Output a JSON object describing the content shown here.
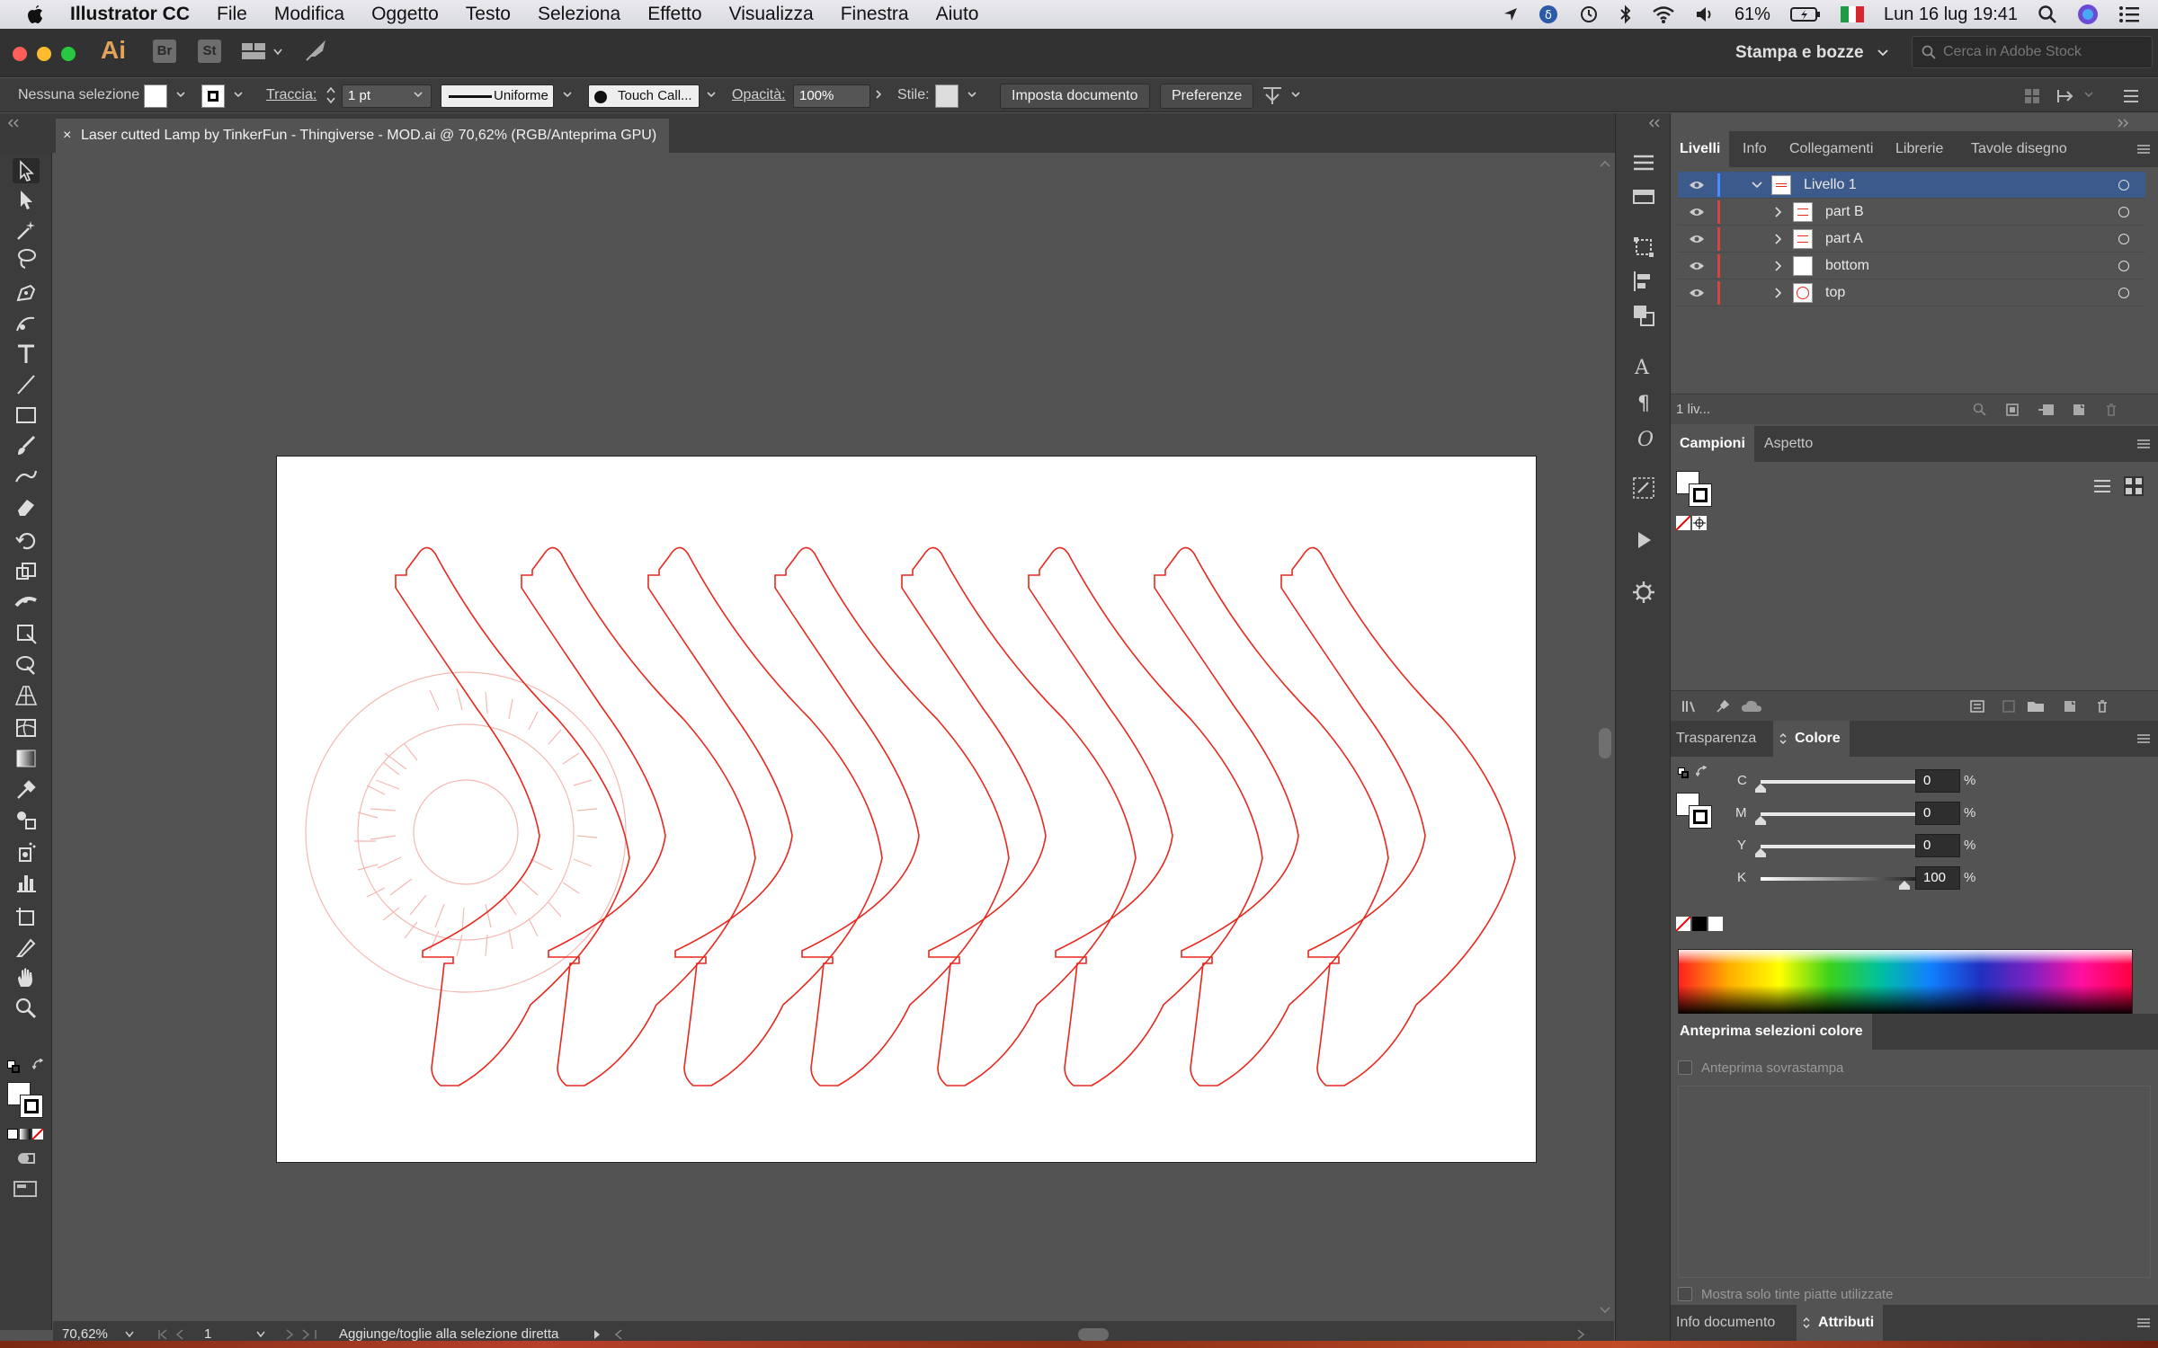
{
  "menubar": {
    "app": "Illustrator CC",
    "items": [
      "File",
      "Modifica",
      "Oggetto",
      "Testo",
      "Seleziona",
      "Effetto",
      "Visualizza",
      "Finestra",
      "Aiuto"
    ],
    "battery": "61%",
    "datetime": "Lun 16 lug 19:41"
  },
  "appbar": {
    "ai_logo": "Ai",
    "bridge": "Br",
    "stock": "St",
    "workspace": "Stampa e bozze",
    "stock_search_placeholder": "Cerca in Adobe Stock"
  },
  "control": {
    "selection": "Nessuna selezione",
    "stroke_label": "Traccia:",
    "stroke_value": "1 pt",
    "profile": "Uniforme",
    "brush": "Touch Call...",
    "opacity_label": "Opacità:",
    "opacity_value": "100%",
    "style_label": "Stile:",
    "doc_setup": "Imposta documento",
    "preferences": "Preferenze"
  },
  "document": {
    "tab_title": "Laser cutted Lamp by TinkerFun - Thingiverse - MOD.ai @ 70,62% (RGB/Anteprima GPU)",
    "close": "×"
  },
  "status": {
    "zoom": "70,62%",
    "artboard": "1",
    "message": "Aggiunge/toglie alla selezione diretta"
  },
  "layers_panel": {
    "tabs": [
      "Livelli",
      "Info",
      "Collegamenti",
      "Librerie",
      "Tavole disegno"
    ],
    "layers": [
      {
        "name": "Livello 1",
        "level": 0
      },
      {
        "name": "part B",
        "level": 1
      },
      {
        "name": "part A",
        "level": 1
      },
      {
        "name": "bottom",
        "level": 1
      },
      {
        "name": "top",
        "level": 1
      }
    ],
    "footer": "1 liv..."
  },
  "swatches_panel": {
    "tabs": [
      "Campioni",
      "Aspetto"
    ]
  },
  "color_panel": {
    "tabs": [
      "Trasparenza",
      "Colore"
    ],
    "channels": [
      {
        "label": "C",
        "value": "0",
        "unit": "%"
      },
      {
        "label": "M",
        "value": "0",
        "unit": "%"
      },
      {
        "label": "Y",
        "value": "0",
        "unit": "%"
      },
      {
        "label": "K",
        "value": "100",
        "unit": "%"
      }
    ]
  },
  "separations_panel": {
    "title": "Anteprima selezioni colore",
    "overprint": "Anteprima sovrastampa",
    "spot_only": "Mostra solo tinte piatte utilizzate"
  },
  "bottom_panel": {
    "tabs": [
      "Info documento",
      "Attributi"
    ]
  },
  "colors": {
    "accent": "#3c5a8c",
    "cut_line": "#e8281e",
    "layer_mark": "#d9443c"
  }
}
